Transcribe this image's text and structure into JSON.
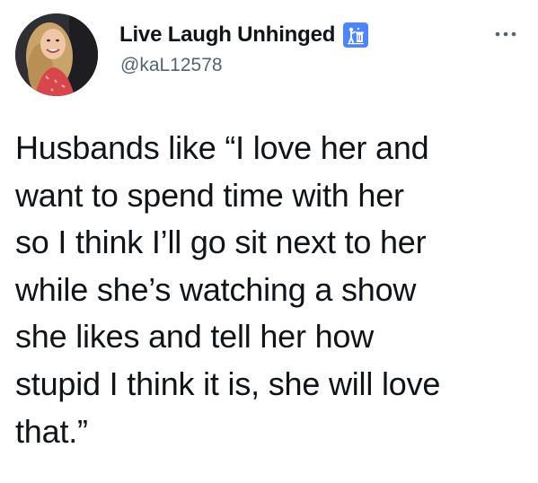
{
  "user": {
    "display_name": "Live Laugh Unhinged",
    "handle": "@kaL12578",
    "badge_icon": "trash-can-person-icon",
    "avatar_icon": "profile-photo-avatar"
  },
  "actions": {
    "more_icon": "more-options-icon"
  },
  "tweet": {
    "lines": [
      "Husbands like “I love her and",
      "want to spend time with her",
      "so I think I’ll go sit next to her",
      "while she’s watching a show",
      "she likes and tell her how",
      "stupid I think it is, she will love",
      "that.”"
    ]
  },
  "colors": {
    "text": "#0f1419",
    "secondary": "#536471",
    "badge": "#4f86f7"
  }
}
